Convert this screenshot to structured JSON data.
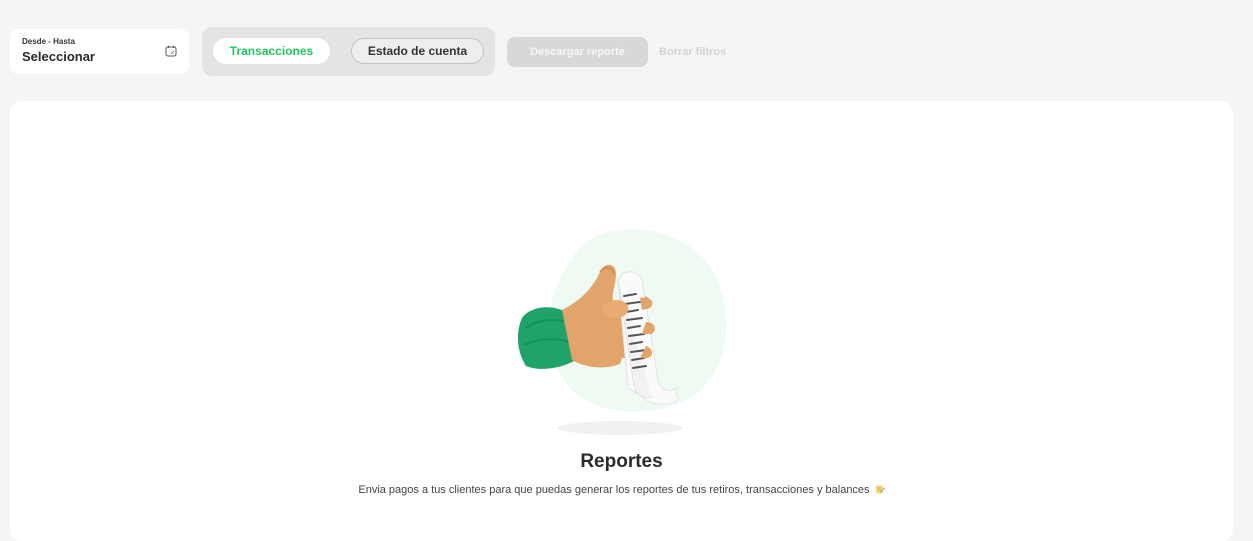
{
  "filters": {
    "date_range_label": "Desde - Hasta",
    "date_range_value": "Seleccionar",
    "date_icon": "calendar-icon"
  },
  "tabs": [
    {
      "label": "Transacciones",
      "active": true
    },
    {
      "label": "Estado de cuenta",
      "active": false
    }
  ],
  "actions": {
    "download_label": "Descargar reporte",
    "clear_label": "Borrar filtros"
  },
  "empty_state": {
    "illustration": "hand-holding-receipt",
    "title": "Reportes",
    "description": "Envia pagos a tus clientes para que puedas generar los reportes de tus retiros, transacciones y balances",
    "trailing_icon": "memo-icon"
  },
  "colors": {
    "accent": "#22c55e",
    "sleeve": "#1fa36a",
    "background": "#f5f5f5"
  }
}
